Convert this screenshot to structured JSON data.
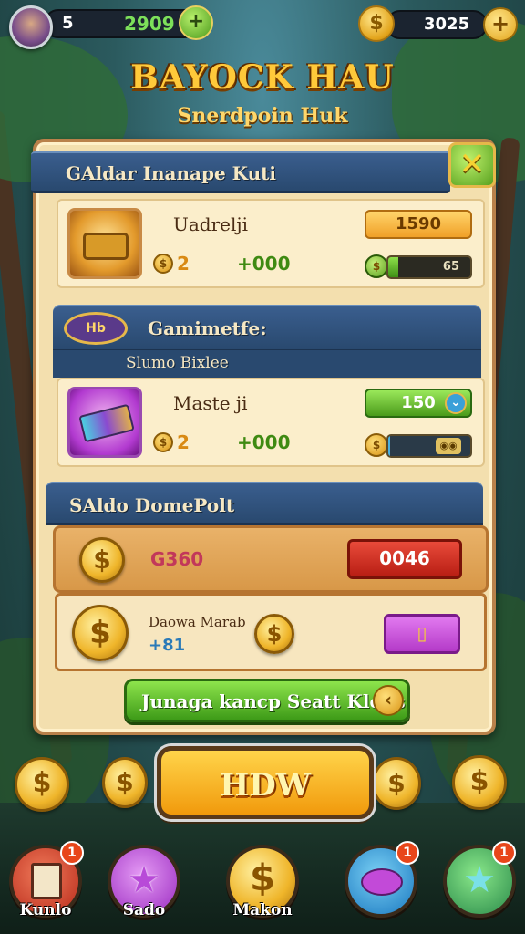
{
  "hud": {
    "level": "5",
    "gold": "2909",
    "coins": "3025"
  },
  "header": {
    "title": "BAYOCK HAU",
    "subtitle": "Snerdpoin Huk"
  },
  "panel": {
    "ribbon_title": "GAldar Inanape Kuti",
    "items": [
      {
        "name": "Uadrelji",
        "count": "2",
        "stat": "+000",
        "price": "1590",
        "progress_label": "65",
        "progress": 0.12
      },
      {
        "name": "Maste ji",
        "count": "2",
        "stat": "+000",
        "price": "150",
        "progress_label": "",
        "progress": 0.02
      }
    ],
    "section2": {
      "ribbon_title": "Gamimetfe:",
      "subheader": "Slumo Bixlee",
      "emblem_text": "Hb"
    },
    "section3": {
      "ribbon_title": "SAldo DomePolt",
      "gold_value": "G360",
      "red_button": "0046",
      "sub_label": "Daowa Marab",
      "sub_value": "+81"
    },
    "action_button": "Junaga kancp Seatt Klous"
  },
  "main_button": "HDW",
  "nav": [
    {
      "label": "Kunlo",
      "badge": "1"
    },
    {
      "label": "Sado",
      "badge": ""
    },
    {
      "label": "Makon",
      "badge": ""
    },
    {
      "label": "",
      "badge": "1"
    },
    {
      "label": "",
      "badge": "1"
    }
  ],
  "colors": {
    "panel_bg": "#f3dfae",
    "ribbon": "#3a5e8e",
    "accent_gold": "#ffc93a",
    "green": "#58a11f",
    "red": "#c9271e",
    "purple": "#c24ad8"
  },
  "icons": [
    "avatar",
    "gold-coin-icon",
    "plus-icon",
    "close-icon",
    "treasure-chest-icon",
    "card-pack-icon",
    "star-icon",
    "chat-icon"
  ]
}
